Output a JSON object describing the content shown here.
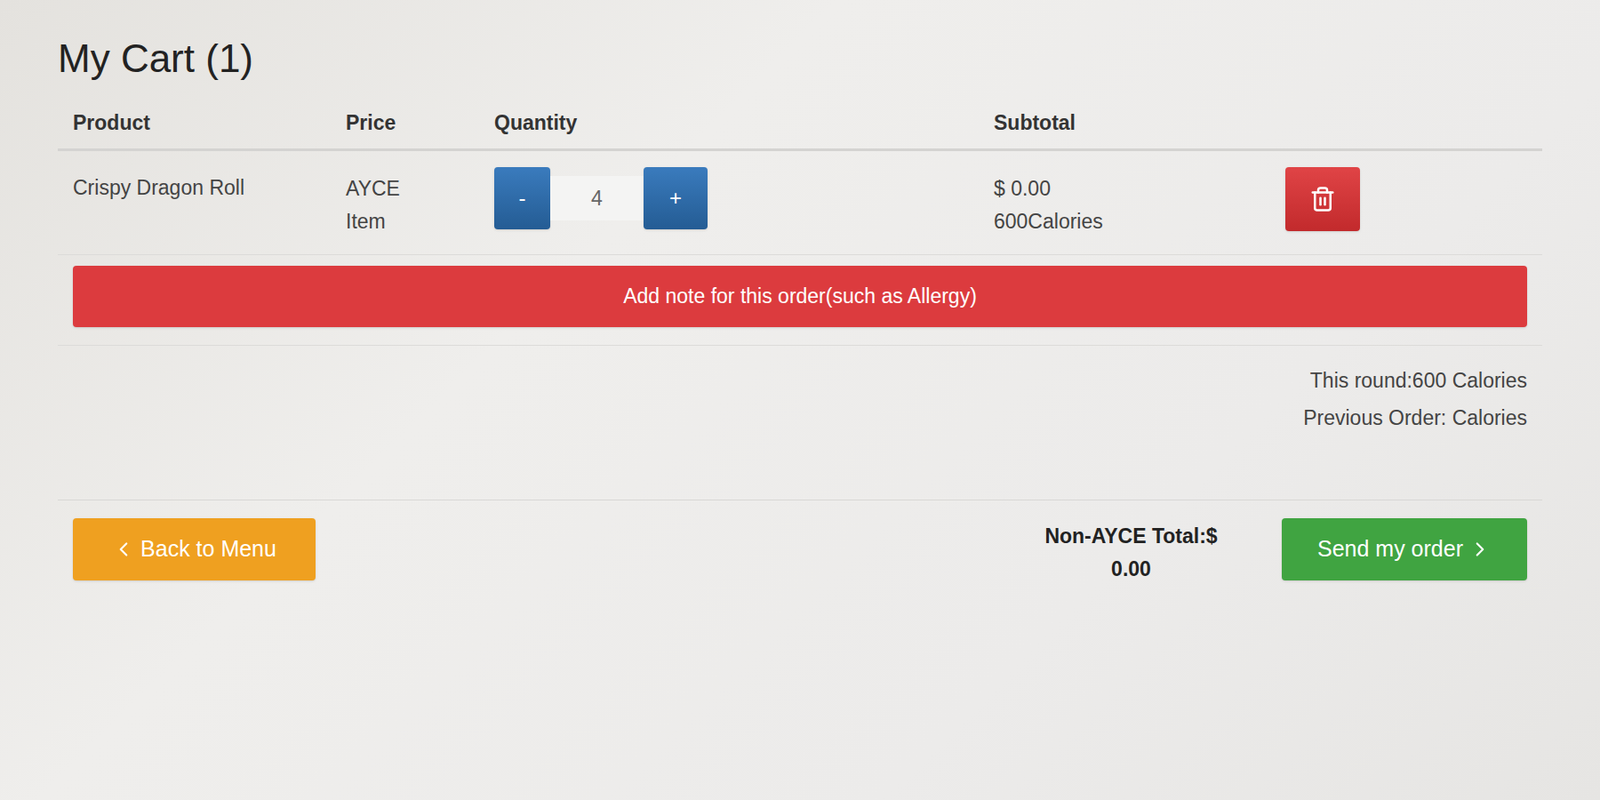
{
  "cart": {
    "title": "My Cart (1)",
    "columns": [
      "Product",
      "Price",
      "Quantity",
      "Subtotal"
    ],
    "items": [
      {
        "name": "Crispy Dragon Roll",
        "price": "AYCE Item",
        "quantity": "4",
        "decrement": "-",
        "increment": "+",
        "subtotal": "$ 0.00",
        "calories": "600Calories"
      }
    ],
    "note_button": "Add note for this order(such as Allergy)",
    "this_round": "This round:600 Calories",
    "previous_order": "Previous Order: Calories",
    "back_button": "Back to Menu",
    "total": "Non-AYCE Total:$ 0.00",
    "send_button": "Send my order"
  }
}
